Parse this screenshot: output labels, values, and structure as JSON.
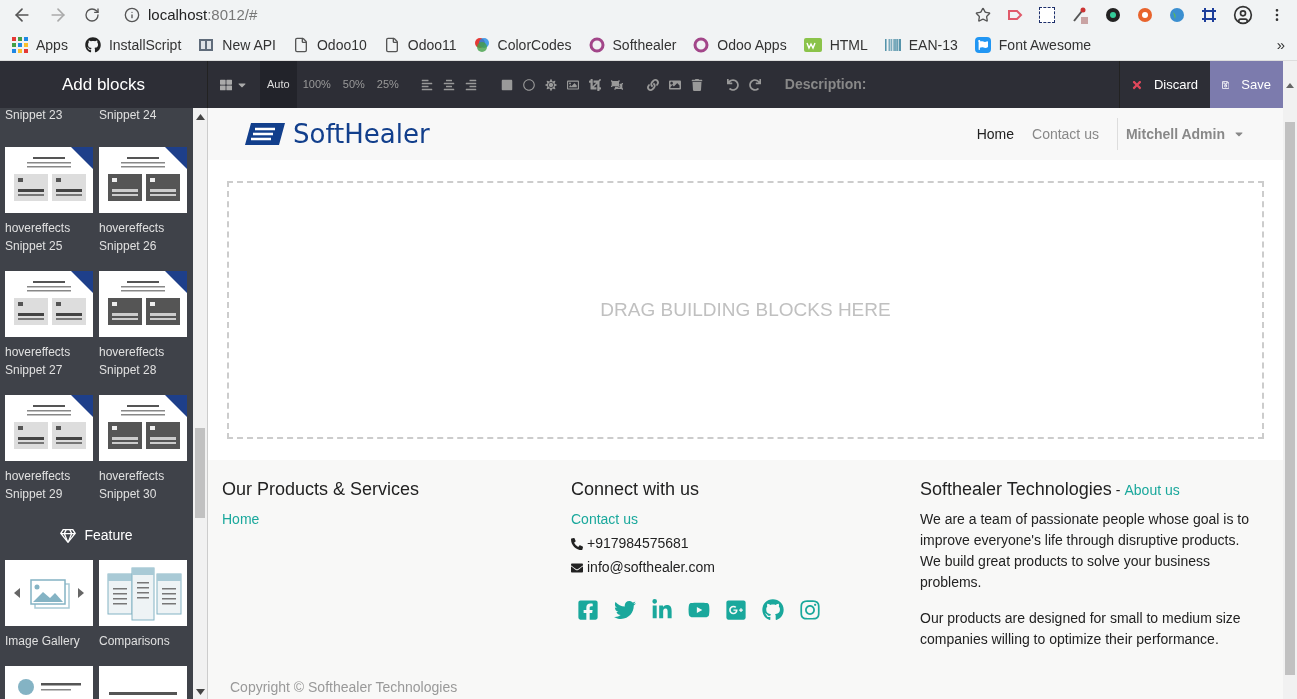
{
  "browser": {
    "url_host": "localhost",
    "url_rest": ":8012/#",
    "bookmarks": [
      {
        "kind": "apps",
        "label": "Apps"
      },
      {
        "kind": "github",
        "label": "InstallScript"
      },
      {
        "kind": "book",
        "label": "New API"
      },
      {
        "kind": "page",
        "label": "Odoo10"
      },
      {
        "kind": "page",
        "label": "Odoo11"
      },
      {
        "kind": "colors",
        "label": "ColorCodes"
      },
      {
        "kind": "ring",
        "label": "Softhealer"
      },
      {
        "kind": "ring",
        "label": "Odoo Apps"
      },
      {
        "kind": "w3",
        "label": "HTML"
      },
      {
        "kind": "barcode",
        "label": "EAN-13"
      },
      {
        "kind": "flag",
        "label": "Font Awesome"
      }
    ],
    "more": "»"
  },
  "editor": {
    "panel_title": "Add blocks",
    "sizes": [
      {
        "label": "Auto",
        "selected": true
      },
      {
        "label": "100%",
        "selected": false
      },
      {
        "label": "50%",
        "selected": false
      },
      {
        "label": "25%",
        "selected": false
      }
    ],
    "description_label": "Description:",
    "discard": "Discard",
    "save": "Save"
  },
  "sidebar": {
    "top_labels": [
      "Snippet 23",
      "Snippet 24"
    ],
    "blocks": [
      {
        "kind": "snippet",
        "label": "hovereffects Snippet 25"
      },
      {
        "kind": "snippet",
        "label": "hovereffects Snippet 26"
      },
      {
        "kind": "snippet",
        "label": "hovereffects Snippet 27"
      },
      {
        "kind": "snippet",
        "label": "hovereffects Snippet 28"
      },
      {
        "kind": "snippet",
        "label": "hovereffects Snippet 29"
      },
      {
        "kind": "snippet",
        "label": "hovereffects Snippet 30"
      }
    ],
    "section": "Feature",
    "feature_blocks": [
      {
        "kind": "gallery",
        "label": "Image Gallery"
      },
      {
        "kind": "comparison",
        "label": "Comparisons"
      },
      {
        "kind": "team"
      },
      {
        "kind": "text"
      }
    ]
  },
  "site": {
    "logo": "SoftHealer",
    "nav": [
      {
        "label": "Home",
        "selected": true
      },
      {
        "label": "Contact us",
        "selected": false
      }
    ],
    "user": "Mitchell Admin",
    "dropzone": "DRAG BUILDING BLOCKS HERE",
    "footer": {
      "col1": {
        "title": "Our Products & Services",
        "links": [
          "Home"
        ]
      },
      "col2": {
        "title": "Connect with us",
        "link": "Contact us",
        "phone": "+917984575681",
        "email": "info@softhealer.com"
      },
      "col3": {
        "title": "Softhealer Technologies",
        "sep": "-",
        "link": "About us",
        "paragraphs": [
          "We are a team of passionate people whose goal is to improve everyone's life through disruptive products. We build great products to solve your business problems.",
          "Our products are designed for small to medium size companies willing to optimize their performance."
        ]
      },
      "copyright": "Copyright © Softhealer Technologies"
    }
  }
}
